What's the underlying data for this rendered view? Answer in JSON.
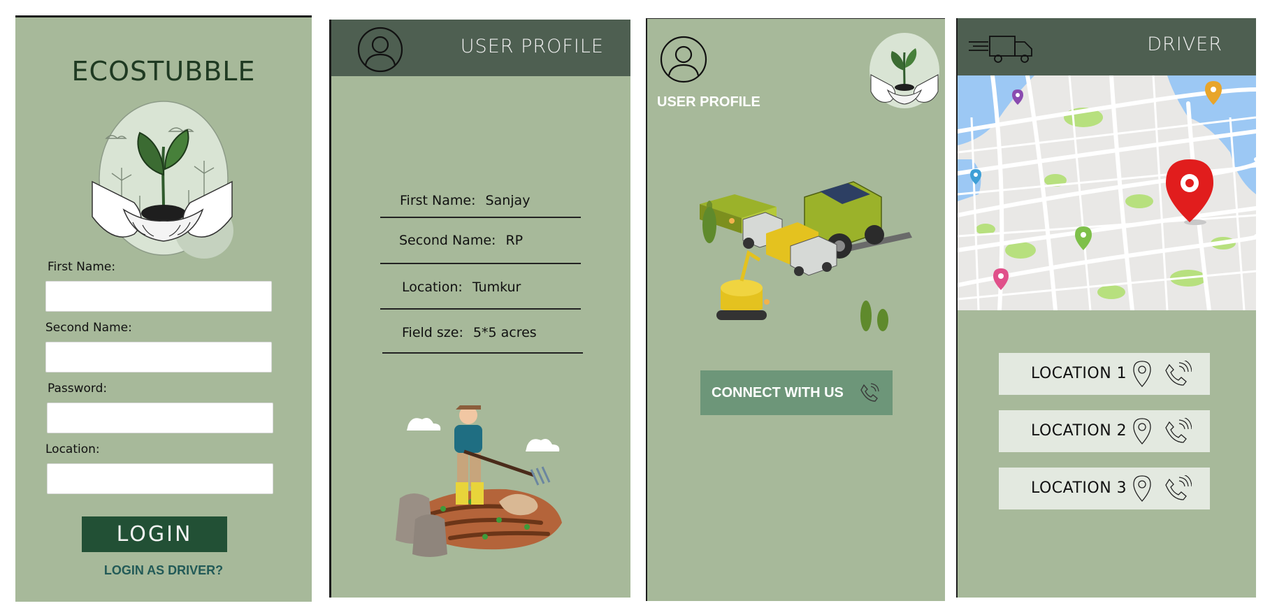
{
  "login_screen": {
    "brand": "ECOSTUBBLE",
    "fields": [
      {
        "label": "First Name:",
        "value": ""
      },
      {
        "label": "Second Name:",
        "value": ""
      },
      {
        "label": "Password:",
        "value": ""
      },
      {
        "label": "Location:",
        "value": ""
      }
    ],
    "login_label": "LOGIN",
    "driver_link": "LOGIN AS DRIVER?"
  },
  "profile_screen": {
    "title": "USER PROFILE",
    "rows": [
      {
        "label": "First Name:",
        "value": "Sanjay"
      },
      {
        "label": "Second Name:",
        "value": "RP"
      },
      {
        "label": "Location:",
        "value": "Tumkur"
      },
      {
        "label": "Field sze:",
        "value": "5*5 acres"
      }
    ]
  },
  "connect_screen": {
    "profile_label": "USER PROFILE",
    "connect_label": "CONNECT WITH US"
  },
  "driver_screen": {
    "title": "DRIVER",
    "locations": [
      "LOCATION 1",
      "LOCATION 2",
      "LOCATION 3"
    ]
  },
  "colors": {
    "panel_bg": "#a7b99a",
    "header_bg": "#4e5f51",
    "login_button": "#225035",
    "connect_button": "#6d9679",
    "location_button": "#e3e9e0"
  },
  "icons": [
    "user-avatar-icon",
    "truck-icon",
    "location-pin-icon",
    "phone-call-icon",
    "sprout-hands-logo"
  ]
}
